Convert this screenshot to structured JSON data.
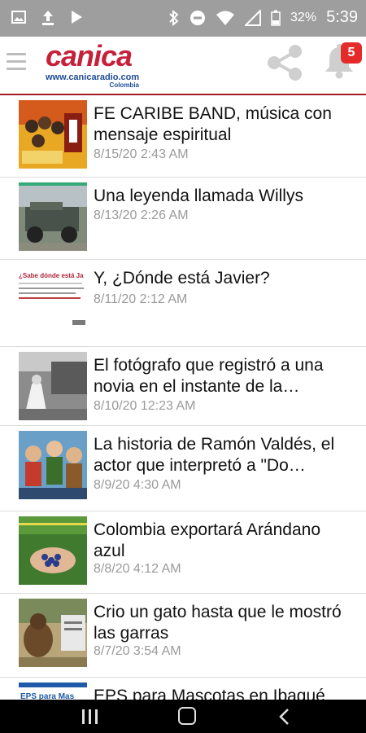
{
  "status_bar": {
    "battery_pct": "32%",
    "time": "5:39"
  },
  "app_bar": {
    "logo_word": "canica",
    "logo_url": "www.canicaradio.com",
    "logo_country": "Colombia",
    "notification_count": "5"
  },
  "articles": [
    {
      "title": "FE CARIBE BAND, música con mensaje espiritual",
      "date": "8/15/20 2:43 AM"
    },
    {
      "title": "Una leyenda llamada Willys",
      "date": "8/13/20 2:26 AM"
    },
    {
      "title": "Y, ¿Dónde está Javier?",
      "date": "8/11/20 2:12 AM"
    },
    {
      "title": "El fotógrafo que registró a una novia en el instante de la…",
      "date": "8/10/20 12:23 AM"
    },
    {
      "title": "La historia de Ramón Valdés, el actor que interpretó a \"Do…",
      "date": "8/9/20 4:30 AM"
    },
    {
      "title": "Colombia exportará Arándano azul",
      "date": "8/8/20 4:12 AM"
    },
    {
      "title": "Crio un gato hasta que le mostró las garras",
      "date": "8/7/20 3:54 AM"
    },
    {
      "title": "EPS para Mascotas en Ibagué",
      "date": ""
    }
  ],
  "thumb_texts": {
    "t3_line1": "¿Sabe dónde está Ja",
    "t8_line1": "EPS para Mas"
  }
}
